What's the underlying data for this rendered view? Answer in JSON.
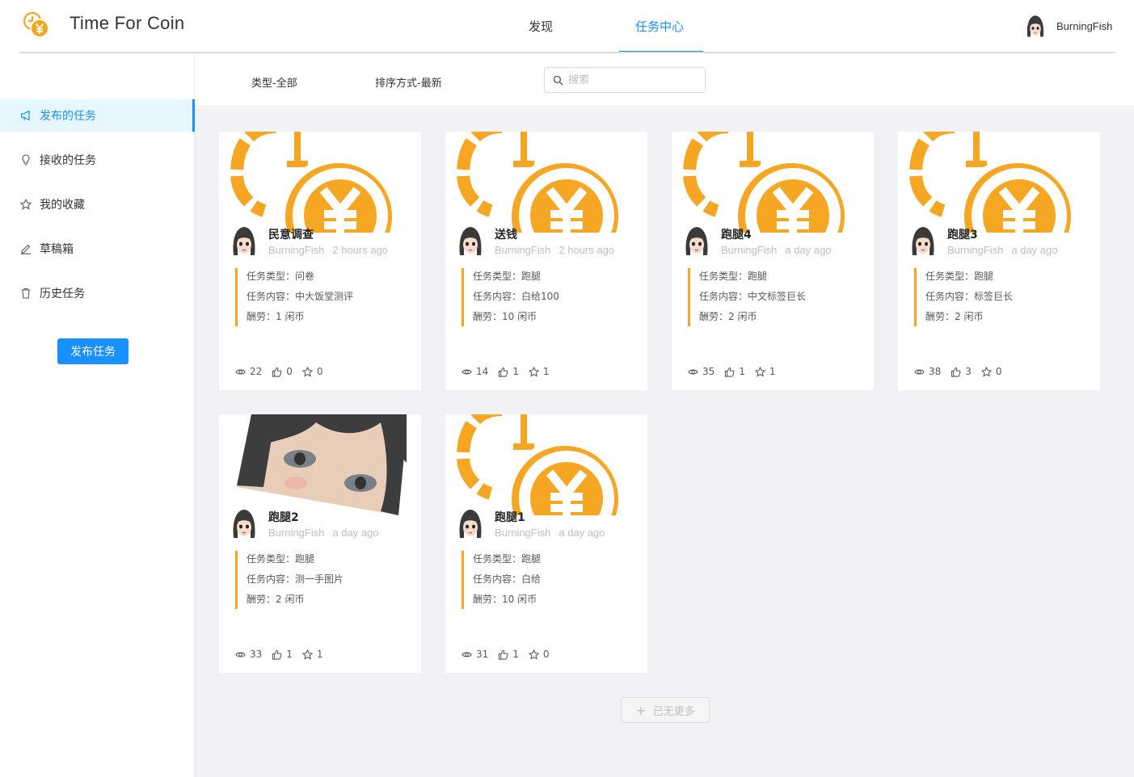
{
  "header": {
    "app_title": "Time For Coin",
    "nav": [
      {
        "label": "发现",
        "active": false
      },
      {
        "label": "任务中心",
        "active": true
      }
    ],
    "user_name": "BurningFish"
  },
  "sidebar": {
    "items": [
      {
        "label": "发布的任务",
        "icon": "megaphone-icon",
        "active": true
      },
      {
        "label": "接收的任务",
        "icon": "lightbulb-icon",
        "active": false
      },
      {
        "label": "我的收藏",
        "icon": "star-icon",
        "active": false
      },
      {
        "label": "草稿箱",
        "icon": "edit-icon",
        "active": false
      },
      {
        "label": "历史任务",
        "icon": "trash-icon",
        "active": false
      }
    ],
    "publish_button": "发布任务"
  },
  "filters": {
    "type": "类型-全部",
    "sort": "排序方式-最新",
    "search_placeholder": "搜索"
  },
  "cards": [
    {
      "title": "民意调查",
      "author": "BurningFish",
      "time": "2 hours ago",
      "type_line": "任务类型：问卷",
      "content_line": "任务内容：中大饭堂测评",
      "reward_line": "酬劳：1 闲币",
      "views": "22",
      "likes": "0",
      "stars": "0",
      "cover": "coin"
    },
    {
      "title": "送钱",
      "author": "BurningFish",
      "time": "2 hours ago",
      "type_line": "任务类型：跑腿",
      "content_line": "任务内容：白给100",
      "reward_line": "酬劳：10 闲币",
      "views": "14",
      "likes": "1",
      "stars": "1",
      "cover": "coin"
    },
    {
      "title": "跑腿4",
      "author": "BurningFish",
      "time": "a day ago",
      "type_line": "任务类型：跑腿",
      "content_line": "任务内容：中文标签巨长",
      "reward_line": "酬劳：2 闲币",
      "views": "35",
      "likes": "1",
      "stars": "1",
      "cover": "coin"
    },
    {
      "title": "跑腿3",
      "author": "BurningFish",
      "time": "a day ago",
      "type_line": "任务类型：跑腿",
      "content_line": "任务内容：标签巨长",
      "reward_line": "酬劳：2 闲币",
      "views": "38",
      "likes": "3",
      "stars": "0",
      "cover": "coin"
    },
    {
      "title": "跑腿2",
      "author": "BurningFish",
      "time": "a day ago",
      "type_line": "任务类型：跑腿",
      "content_line": "任务内容：测一手图片",
      "reward_line": "酬劳：2 闲币",
      "views": "33",
      "likes": "1",
      "stars": "1",
      "cover": "photo"
    },
    {
      "title": "跑腿1",
      "author": "BurningFish",
      "time": "a day ago",
      "type_line": "任务类型：跑腿",
      "content_line": "任务内容：白给",
      "reward_line": "酬劳：10 闲币",
      "views": "31",
      "likes": "1",
      "stars": "0",
      "cover": "coin"
    }
  ],
  "load_more": "已无更多",
  "colors": {
    "accent": "#1890ff",
    "coin": "#f5a623",
    "background": "#f0f2f5"
  }
}
